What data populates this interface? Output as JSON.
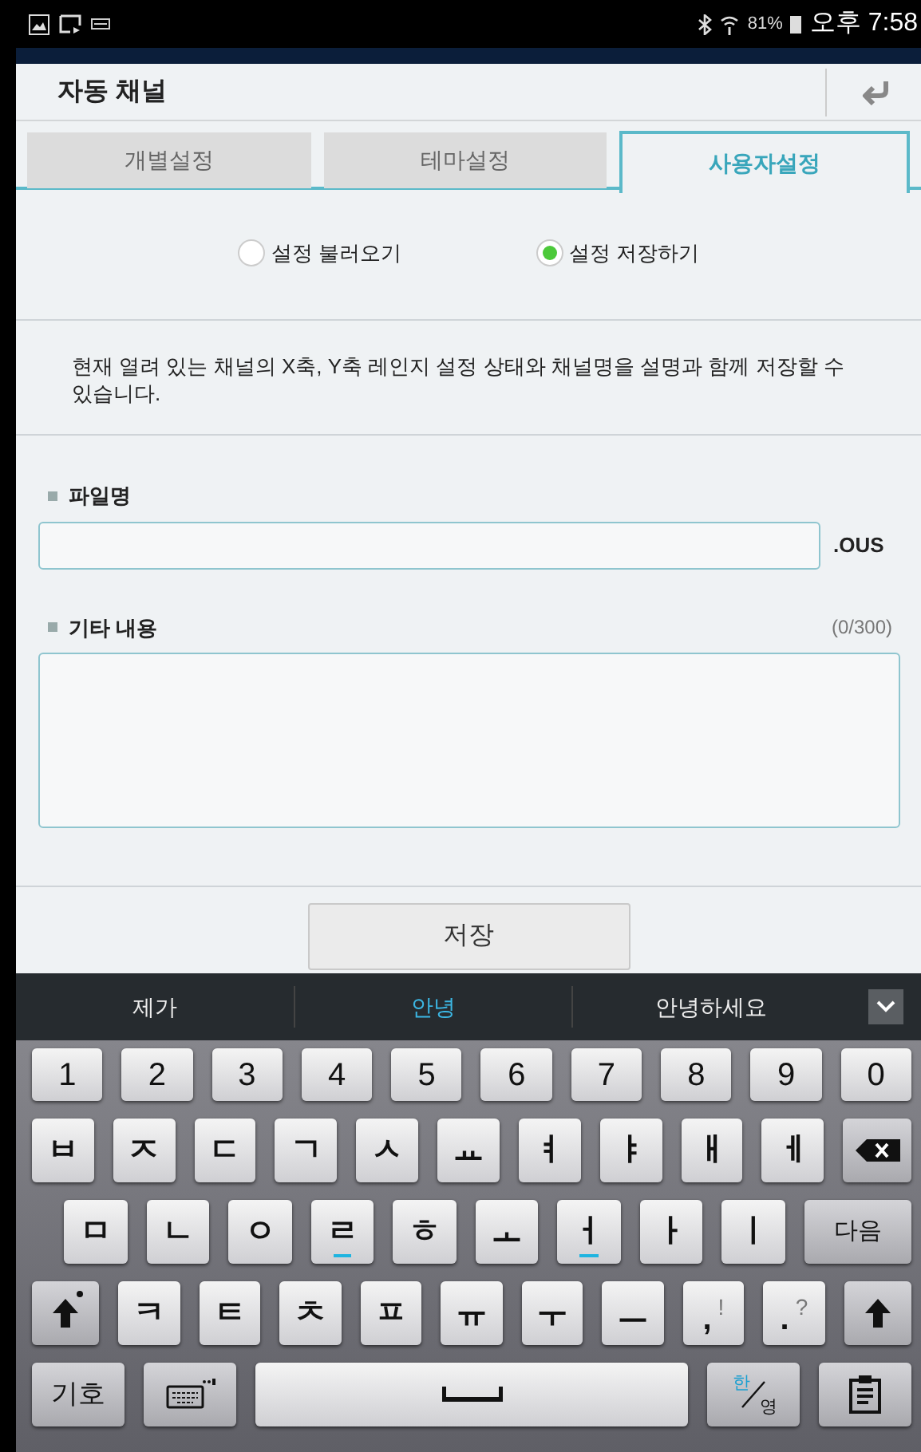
{
  "status_bar": {
    "battery": "81%",
    "time": "오후 7:58"
  },
  "dialog": {
    "title": "자동 채널"
  },
  "tabs": [
    {
      "label": "개별설정",
      "selected": false
    },
    {
      "label": "테마설정",
      "selected": false
    },
    {
      "label": "사용자설정",
      "selected": true
    }
  ],
  "radios": [
    {
      "label": "설정 불러오기",
      "selected": false
    },
    {
      "label": "설정 저장하기",
      "selected": true
    }
  ],
  "description": "현재 열려 있는 채널의 X축, Y축 레인지 설정 상태와 채널명을 설명과 함께 저장할 수 있습니다.",
  "file_name": {
    "label": "파일명",
    "extension": ".OUS"
  },
  "notes": {
    "label": "기타 내용",
    "counter": "(0/300)"
  },
  "save_button": "저장",
  "suggestions": [
    {
      "label": "제가",
      "selected": false
    },
    {
      "label": "안녕",
      "selected": true
    },
    {
      "label": "안녕하세요",
      "selected": false
    }
  ],
  "keyboard_rows": [
    [
      {
        "kind": "char",
        "label": "1"
      },
      {
        "kind": "char",
        "label": "2"
      },
      {
        "kind": "char",
        "label": "3"
      },
      {
        "kind": "char",
        "label": "4"
      },
      {
        "kind": "char",
        "label": "5"
      },
      {
        "kind": "char",
        "label": "6"
      },
      {
        "kind": "char",
        "label": "7"
      },
      {
        "kind": "char",
        "label": "8"
      },
      {
        "kind": "char",
        "label": "9"
      },
      {
        "kind": "char",
        "label": "0"
      }
    ],
    [
      {
        "kind": "char",
        "label": "ㅂ"
      },
      {
        "kind": "char",
        "label": "ㅈ"
      },
      {
        "kind": "char",
        "label": "ㄷ"
      },
      {
        "kind": "char",
        "label": "ㄱ"
      },
      {
        "kind": "char",
        "label": "ㅅ"
      },
      {
        "kind": "char",
        "label": "ㅛ"
      },
      {
        "kind": "char",
        "label": "ㅕ"
      },
      {
        "kind": "char",
        "label": "ㅑ"
      },
      {
        "kind": "char",
        "label": "ㅐ"
      },
      {
        "kind": "char",
        "label": "ㅔ"
      },
      {
        "kind": "backspace"
      }
    ],
    [
      {
        "kind": "char",
        "label": "ㅁ",
        "underlined": false
      },
      {
        "kind": "char",
        "label": "ㄴ",
        "underlined": false
      },
      {
        "kind": "char",
        "label": "ㅇ",
        "underlined": false
      },
      {
        "kind": "char",
        "label": "ㄹ",
        "underlined": true
      },
      {
        "kind": "char",
        "label": "ㅎ",
        "underlined": false
      },
      {
        "kind": "char",
        "label": "ㅗ",
        "underlined": false
      },
      {
        "kind": "char",
        "label": "ㅓ",
        "underlined": true
      },
      {
        "kind": "char",
        "label": "ㅏ",
        "underlined": false
      },
      {
        "kind": "char",
        "label": "ㅣ",
        "underlined": false
      },
      {
        "kind": "next",
        "label": "다음"
      }
    ],
    [
      {
        "kind": "shift",
        "dot": true
      },
      {
        "kind": "char",
        "label": "ㅋ"
      },
      {
        "kind": "char",
        "label": "ㅌ"
      },
      {
        "kind": "char",
        "label": "ㅊ"
      },
      {
        "kind": "char",
        "label": "ㅍ"
      },
      {
        "kind": "char",
        "label": "ㅠ"
      },
      {
        "kind": "char",
        "label": "ㅜ"
      },
      {
        "kind": "char",
        "label": "ㅡ"
      },
      {
        "kind": "punct",
        "label": ",",
        "alt": "!"
      },
      {
        "kind": "punct",
        "label": ".",
        "alt": "?"
      },
      {
        "kind": "shift",
        "dot": false
      }
    ],
    [
      {
        "kind": "symbols",
        "label": "기호"
      },
      {
        "kind": "keyboard"
      },
      {
        "kind": "space"
      },
      {
        "kind": "lang",
        "label": "한",
        "label2": "영"
      },
      {
        "kind": "clipboard"
      }
    ]
  ]
}
